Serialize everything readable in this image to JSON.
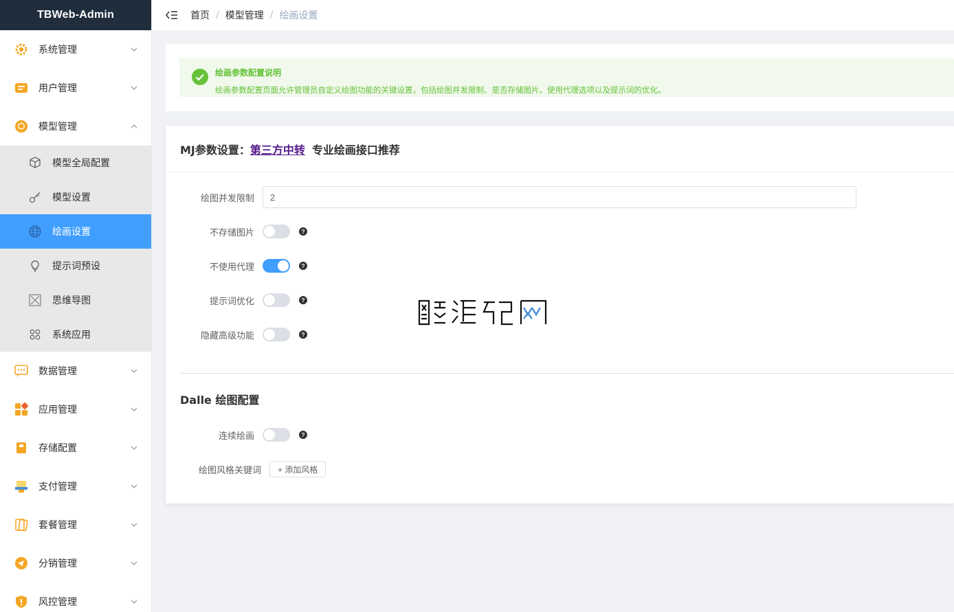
{
  "app": {
    "title": "TBWeb-Admin"
  },
  "sidebar": {
    "items": [
      {
        "label": "系统管理",
        "icon": "gear-icon",
        "expanded": false
      },
      {
        "label": "用户管理",
        "icon": "user-card-icon",
        "expanded": false
      },
      {
        "label": "模型管理",
        "icon": "model-icon",
        "expanded": true,
        "children": [
          {
            "label": "模型全局配置",
            "icon": "cube-icon"
          },
          {
            "label": "模型设置",
            "icon": "key-icon"
          },
          {
            "label": "绘画设置",
            "icon": "globe-icon",
            "active": true
          },
          {
            "label": "提示词预设",
            "icon": "lightbulb-icon"
          },
          {
            "label": "思维导图",
            "icon": "mindmap-icon"
          },
          {
            "label": "系统应用",
            "icon": "apps-grid-icon"
          }
        ]
      },
      {
        "label": "数据管理",
        "icon": "chat-data-icon",
        "expanded": false
      },
      {
        "label": "应用管理",
        "icon": "app-blocks-icon",
        "expanded": false
      },
      {
        "label": "存储配置",
        "icon": "storage-icon",
        "expanded": false
      },
      {
        "label": "支付管理",
        "icon": "payment-icon",
        "expanded": false
      },
      {
        "label": "套餐管理",
        "icon": "package-card-icon",
        "expanded": false
      },
      {
        "label": "分销管理",
        "icon": "send-icon",
        "expanded": false
      },
      {
        "label": "风控管理",
        "icon": "shield-icon",
        "expanded": false
      }
    ]
  },
  "breadcrumb": {
    "items": [
      "首页",
      "模型管理",
      "绘画设置"
    ],
    "separator": "/"
  },
  "notice": {
    "title": "绘画参数配置说明",
    "description": "绘画参数配置页面允许管理员自定义绘图功能的关键设置，包括绘图并发限制、是否存储图片、使用代理选项以及提示词的优化。"
  },
  "mj": {
    "header_prefix": "MJ参数设置：",
    "header_link": "第三方中转",
    "header_suffix": "专业绘画接口推荐",
    "fields": {
      "concurrency_label": "绘图并发限制",
      "concurrency_value": "2",
      "no_store_label": "不存储图片",
      "no_store_on": false,
      "no_proxy_label": "不使用代理",
      "no_proxy_on": true,
      "prompt_opt_label": "提示词优化",
      "prompt_opt_on": false,
      "hide_adv_label": "隐藏高级功能",
      "hide_adv_on": false
    }
  },
  "dalle": {
    "title": "Dalle 绘图配置",
    "continuous_label": "连续绘画",
    "continuous_on": false,
    "style_label": "绘图风格关键词",
    "add_style_button": "+ 添加风格"
  },
  "colors": {
    "primary": "#409eff",
    "sidebar_header": "#1f2d3d",
    "success": "#67c23a",
    "menu_icon": "#f5a623"
  }
}
